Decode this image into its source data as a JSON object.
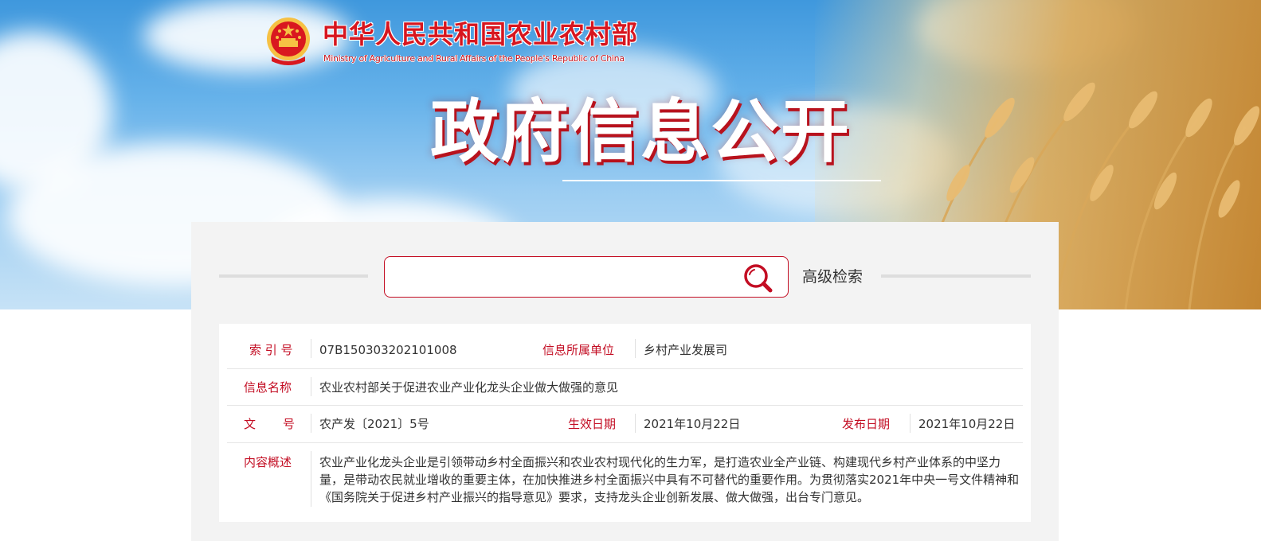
{
  "header": {
    "ministry_name": "中华人民共和国农业农村部",
    "ministry_name_en": "Ministry of Agriculture and Rural Affairs of the People's Republic of China",
    "emblem": "national-emblem-icon",
    "section_title": "政府信息公开"
  },
  "search": {
    "placeholder": "",
    "value": "",
    "icon": "search-icon",
    "advanced_label": "高级检索"
  },
  "info": {
    "index_label": "索 引 号",
    "index_value": "07B150303202101008",
    "org_label": "信息所属单位",
    "org_value": "乡村产业发展司",
    "name_label": "信息名称",
    "name_value": "农业农村部关于促进农业产业化龙头企业做大做强的意见",
    "doc_label": "文 号",
    "doc_value": "农产发〔2021〕5号",
    "effective_label": "生效日期",
    "effective_value": "2021年10月22日",
    "publish_label": "发布日期",
    "publish_value": "2021年10月22日",
    "summary_label": "内容概述",
    "summary_value": "农业产业化龙头企业是引领带动乡村全面振兴和农业农村现代化的生力军，是打造农业全产业链、构建现代乡村产业体系的中坚力量，是带动农民就业增收的重要主体，在加快推进乡村全面振兴中具有不可替代的重要作用。为贯彻落实2021年中央一号文件精神和《国务院关于促进乡村产业振兴的指导意见》要求，支持龙头企业创新发展、做大做强，出台专门意见。"
  },
  "colors": {
    "accent": "#c30d23",
    "panel_bg": "#f3f3f3",
    "text": "#333333"
  }
}
